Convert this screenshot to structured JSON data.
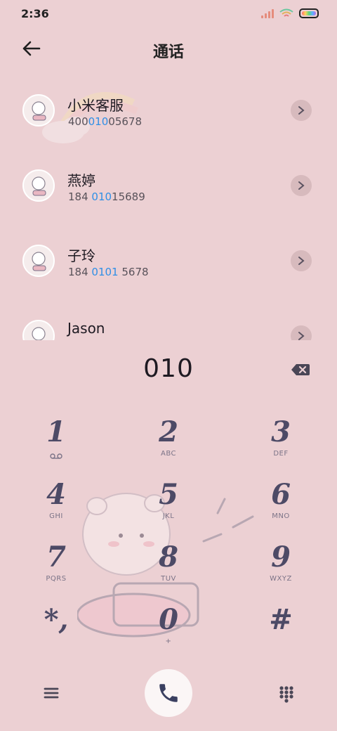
{
  "status": {
    "time": "2:36"
  },
  "header": {
    "title": "通话"
  },
  "contacts": [
    {
      "name": "小米客服",
      "num_pre": "400",
      "num_hl": "010",
      "num_post": "05678"
    },
    {
      "name": "燕婷",
      "num_pre": "184 ",
      "num_hl": "010",
      "num_post": "15689"
    },
    {
      "name": "子玲",
      "num_pre": "184 ",
      "num_hl": "0101",
      "num_post": " 5678"
    },
    {
      "name": "Jason",
      "num_pre": "",
      "num_hl": "",
      "num_post": ""
    }
  ],
  "dialer": {
    "input": "010",
    "keys": [
      {
        "digit": "1",
        "letters": ""
      },
      {
        "digit": "2",
        "letters": "ABC"
      },
      {
        "digit": "3",
        "letters": "DEF"
      },
      {
        "digit": "4",
        "letters": "GHI"
      },
      {
        "digit": "5",
        "letters": "JKL"
      },
      {
        "digit": "6",
        "letters": "MNO"
      },
      {
        "digit": "7",
        "letters": "PQRS"
      },
      {
        "digit": "8",
        "letters": "TUV"
      },
      {
        "digit": "9",
        "letters": "WXYZ"
      },
      {
        "digit": "*,",
        "letters": ""
      },
      {
        "digit": "0",
        "letters": "+"
      },
      {
        "digit": "#",
        "letters": ""
      }
    ]
  },
  "icons": {
    "back": "arrow-left-icon",
    "backspace": "backspace-icon",
    "menu": "menu-icon",
    "call": "phone-icon",
    "dialpad": "dialpad-icon",
    "voicemail": "voicemail-icon"
  },
  "colors": {
    "background": "#ecd0d3",
    "highlight": "#2f8fe6",
    "digit": "#4d4a66"
  }
}
